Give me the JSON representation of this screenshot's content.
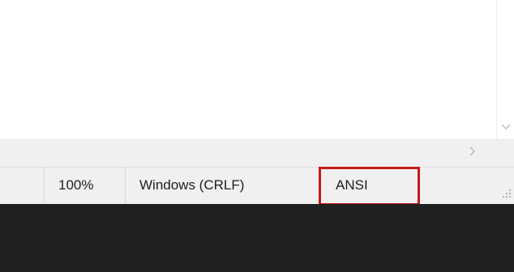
{
  "statusbar": {
    "zoom": "100%",
    "line_ending": "Windows (CRLF)",
    "encoding": "ANSI"
  },
  "icons": {
    "vscroll_down": "chevron-down-icon",
    "hscroll_right": "chevron-right-icon",
    "resize_grip": "resize-grip-icon"
  },
  "colors": {
    "highlight": "#c5191b",
    "taskbar": "#202020",
    "statusbar_bg": "#f0f0f0"
  }
}
